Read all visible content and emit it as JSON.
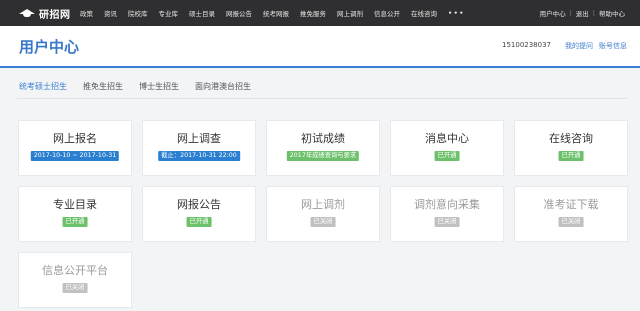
{
  "nav": {
    "logo_text": "研招网",
    "items": [
      "政策",
      "资讯",
      "院校库",
      "专业库",
      "硕士目录",
      "网报公告",
      "统考网报",
      "推免服务",
      "网上调剂",
      "信息公开",
      "在线咨询"
    ],
    "more": "•••",
    "user_center": "用户中心",
    "logout": "退出",
    "help": "帮助中心"
  },
  "header": {
    "title": "用户中心",
    "phone": "15100238037",
    "my_questions": "我的提问",
    "account_mgmt": "账号信息"
  },
  "tabs": [
    "统考硕士招生",
    "推免生招生",
    "博士生招生",
    "面向港澳台招生"
  ],
  "active_tab": 0,
  "cards": [
    {
      "title": "网上报名",
      "badge": "2017-10-10 ~ 2017-10-31",
      "badge_color": "#2b7fd0",
      "enabled": true
    },
    {
      "title": "网上调查",
      "badge": "截止：2017-10-31 22:00",
      "badge_color": "#2b7fd0",
      "enabled": true
    },
    {
      "title": "初试成绩",
      "badge": "2017年成绩查询与要求",
      "badge_color": "#6cc16a",
      "enabled": true
    },
    {
      "title": "消息中心",
      "badge": "已开通",
      "badge_color": "#6cc16a",
      "enabled": true
    },
    {
      "title": "在线咨询",
      "badge": "已开通",
      "badge_color": "#6cc16a",
      "enabled": true
    },
    {
      "title": "专业目录",
      "badge": "已开通",
      "badge_color": "#6cc16a",
      "enabled": true
    },
    {
      "title": "网报公告",
      "badge": "已开通",
      "badge_color": "#6cc16a",
      "enabled": true
    },
    {
      "title": "网上调剂",
      "badge": "已关闭",
      "badge_color": "#c1c1c1",
      "enabled": false
    },
    {
      "title": "调剂意向采集",
      "badge": "已关闭",
      "badge_color": "#c1c1c1",
      "enabled": false
    },
    {
      "title": "准考证下载",
      "badge": "已关闭",
      "badge_color": "#c1c1c1",
      "enabled": false
    },
    {
      "title": "信息公开平台",
      "badge": "已关闭",
      "badge_color": "#c1c1c1",
      "enabled": false
    }
  ]
}
